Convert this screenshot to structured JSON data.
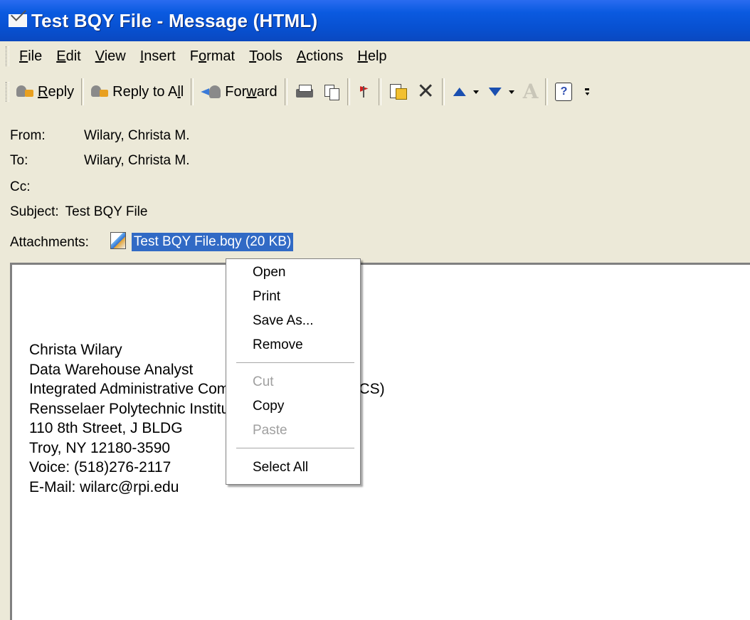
{
  "window": {
    "title": "Test BQY File - Message (HTML)"
  },
  "menubar": {
    "items": [
      {
        "pre": "",
        "u": "F",
        "post": "ile"
      },
      {
        "pre": "",
        "u": "E",
        "post": "dit"
      },
      {
        "pre": "",
        "u": "V",
        "post": "iew"
      },
      {
        "pre": "",
        "u": "I",
        "post": "nsert"
      },
      {
        "pre": "F",
        "u": "o",
        "post": "rmat"
      },
      {
        "pre": "",
        "u": "T",
        "post": "ools"
      },
      {
        "pre": "",
        "u": "A",
        "post": "ctions"
      },
      {
        "pre": "",
        "u": "H",
        "post": "elp"
      }
    ]
  },
  "toolbar": {
    "reply": {
      "u": "R",
      "post": "eply"
    },
    "reply_all": {
      "pre": "Reply to A",
      "u": "l",
      "post": "l"
    },
    "forward": {
      "pre": "For",
      "u": "w",
      "post": "ard"
    }
  },
  "header": {
    "from_label": "From:",
    "from_value": "Wilary, Christa M.",
    "to_label": "To:",
    "to_value": "Wilary, Christa M.",
    "cc_label": "Cc:",
    "cc_value": "",
    "subject_label": "Subject:",
    "subject_value": "Test BQY File",
    "attachments_label": "Attachments:",
    "attachment_name": "Test BQY File.bqy (20 KB)"
  },
  "body": {
    "signature_lines": [
      "Christa Wilary",
      "Data Warehouse Analyst",
      "Integrated Administrative Computing Solutions (IACS)",
      "Rensselaer Polytechnic Institute",
      "110 8th Street, J BLDG",
      "Troy, NY 12180-3590",
      "Voice: (518)276-2117",
      "E-Mail: wilarc@rpi.edu"
    ]
  },
  "context_menu": {
    "open": "Open",
    "print": "Print",
    "save_as": "Save As...",
    "remove": "Remove",
    "cut": "Cut",
    "copy": "Copy",
    "paste": "Paste",
    "select_all": "Select All"
  }
}
